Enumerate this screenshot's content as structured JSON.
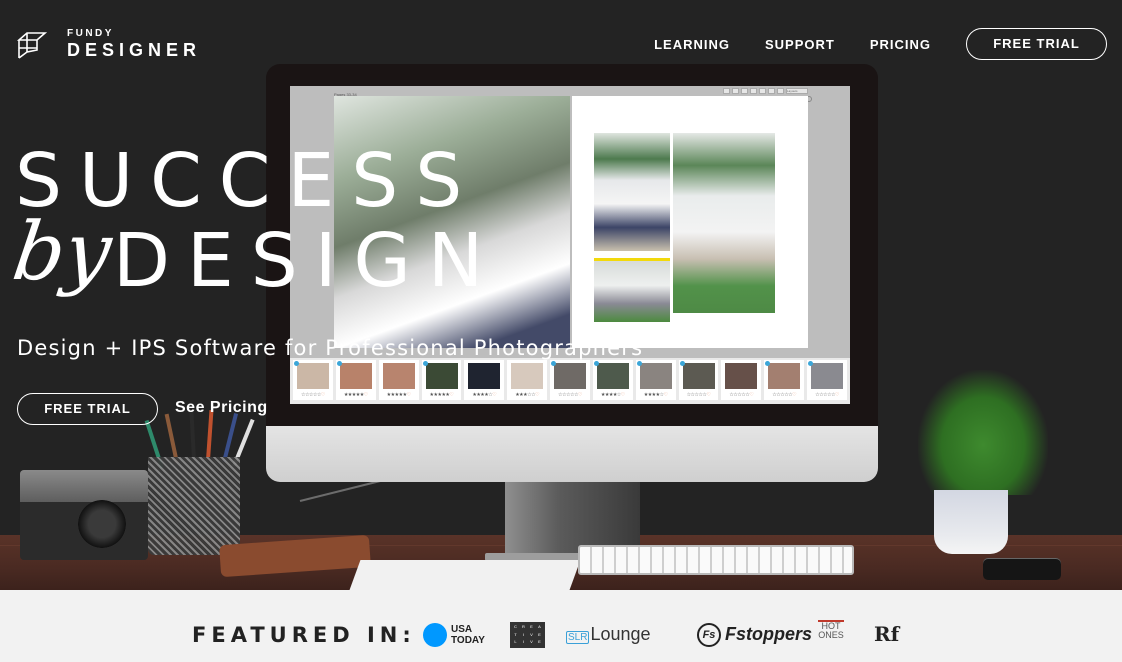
{
  "header": {
    "logo_top": "FUNDY",
    "logo_bottom": "DESIGNER",
    "nav": [
      {
        "label": "LEARNING"
      },
      {
        "label": "SUPPORT"
      },
      {
        "label": "PRICING"
      }
    ],
    "trial_label": "FREE TRIAL"
  },
  "hero": {
    "line1": "SUCCESS",
    "script_word": "by",
    "line2": "DESIGN",
    "tagline": "Design + IPS Software for Professional Photographers",
    "cta_primary": "FREE TRIAL",
    "cta_secondary": "See Pricing"
  },
  "app_screen": {
    "pages_label": "Pages 33-34",
    "layouts_label": "Layouts",
    "thumbnails": [
      {
        "stars": 0,
        "badge": true,
        "color": "#cbb7a6"
      },
      {
        "stars": 5,
        "badge": true,
        "color": "#b8826a"
      },
      {
        "stars": 5,
        "badge": false,
        "color": "#b8846e"
      },
      {
        "stars": 5,
        "badge": true,
        "color": "#3b4a35"
      },
      {
        "stars": 4,
        "badge": false,
        "color": "#1f2430"
      },
      {
        "stars": 3,
        "badge": false,
        "color": "#d7c9bd"
      },
      {
        "stars": 0,
        "badge": true,
        "color": "#6f6a66"
      },
      {
        "stars": 4,
        "badge": true,
        "color": "#4e5a4c"
      },
      {
        "stars": 4,
        "badge": true,
        "color": "#8a8480"
      },
      {
        "stars": 0,
        "badge": true,
        "color": "#5c5a52"
      },
      {
        "stars": 0,
        "badge": false,
        "color": "#665049"
      },
      {
        "stars": 0,
        "badge": true,
        "color": "#a37f70"
      },
      {
        "stars": 0,
        "badge": true,
        "color": "#8a8a90"
      }
    ]
  },
  "featured": {
    "label": "FEATURED IN:",
    "logos": [
      {
        "name": "USA TODAY",
        "line1": "USA",
        "line2": "TODAY",
        "color": "#0098ff"
      },
      {
        "name": "CreativeLive",
        "letters": [
          "C",
          "R",
          "E",
          "A",
          "T",
          "I",
          "V",
          "E",
          "L",
          "I",
          "V",
          "E"
        ]
      },
      {
        "name": "SLR Lounge",
        "mark": "SLR",
        "text": "Lounge"
      },
      {
        "name": "Fstoppers",
        "mark": "Fs",
        "text": "Fstoppers"
      },
      {
        "name": "Hot Ones",
        "text": "HOT ONES"
      },
      {
        "name": "Rangefinder",
        "text": "Rf"
      }
    ]
  },
  "colors": {
    "background": "#232323",
    "featured_bg": "#f2f2f2",
    "accent_blue": "#0098ff"
  }
}
